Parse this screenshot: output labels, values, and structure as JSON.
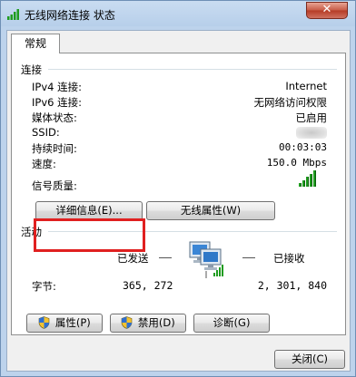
{
  "window": {
    "title": "无线网络连接 状态",
    "close_glyph": "✕"
  },
  "tabs": [
    {
      "label": "常规"
    }
  ],
  "connection": {
    "group_label": "连接",
    "rows": [
      {
        "label": "IPv4 连接:",
        "value": "Internet"
      },
      {
        "label": "IPv6 连接:",
        "value": "无网络访问权限"
      },
      {
        "label": "媒体状态:",
        "value": "已启用"
      },
      {
        "label": "SSID:",
        "value": ""
      },
      {
        "label": "持续时间:",
        "value": "00:03:03"
      },
      {
        "label": "速度:",
        "value": "150.0 Mbps"
      }
    ],
    "signal_label": "信号质量:",
    "signal_bars": 5,
    "signal_level": 5
  },
  "buttons": {
    "details": "详细信息(E)...",
    "wireless_properties": "无线属性(W)",
    "properties": "属性(P)",
    "disable": "禁用(D)",
    "diagnose": "诊断(G)",
    "close": "关闭(C)"
  },
  "activity": {
    "group_label": "活动",
    "sent_label": "已发送",
    "received_label": "已接收",
    "bytes_label": "字节:",
    "bytes_sent": "365, 272",
    "bytes_received": "2, 301, 840"
  },
  "colors": {
    "signal_green": "#1f9c1f",
    "highlight_red": "#e02020",
    "title_bar": "#c9dcf1"
  },
  "icons": [
    "wireless-signal-icon",
    "close-icon",
    "uac-shield-icon",
    "network-computers-icon"
  ]
}
